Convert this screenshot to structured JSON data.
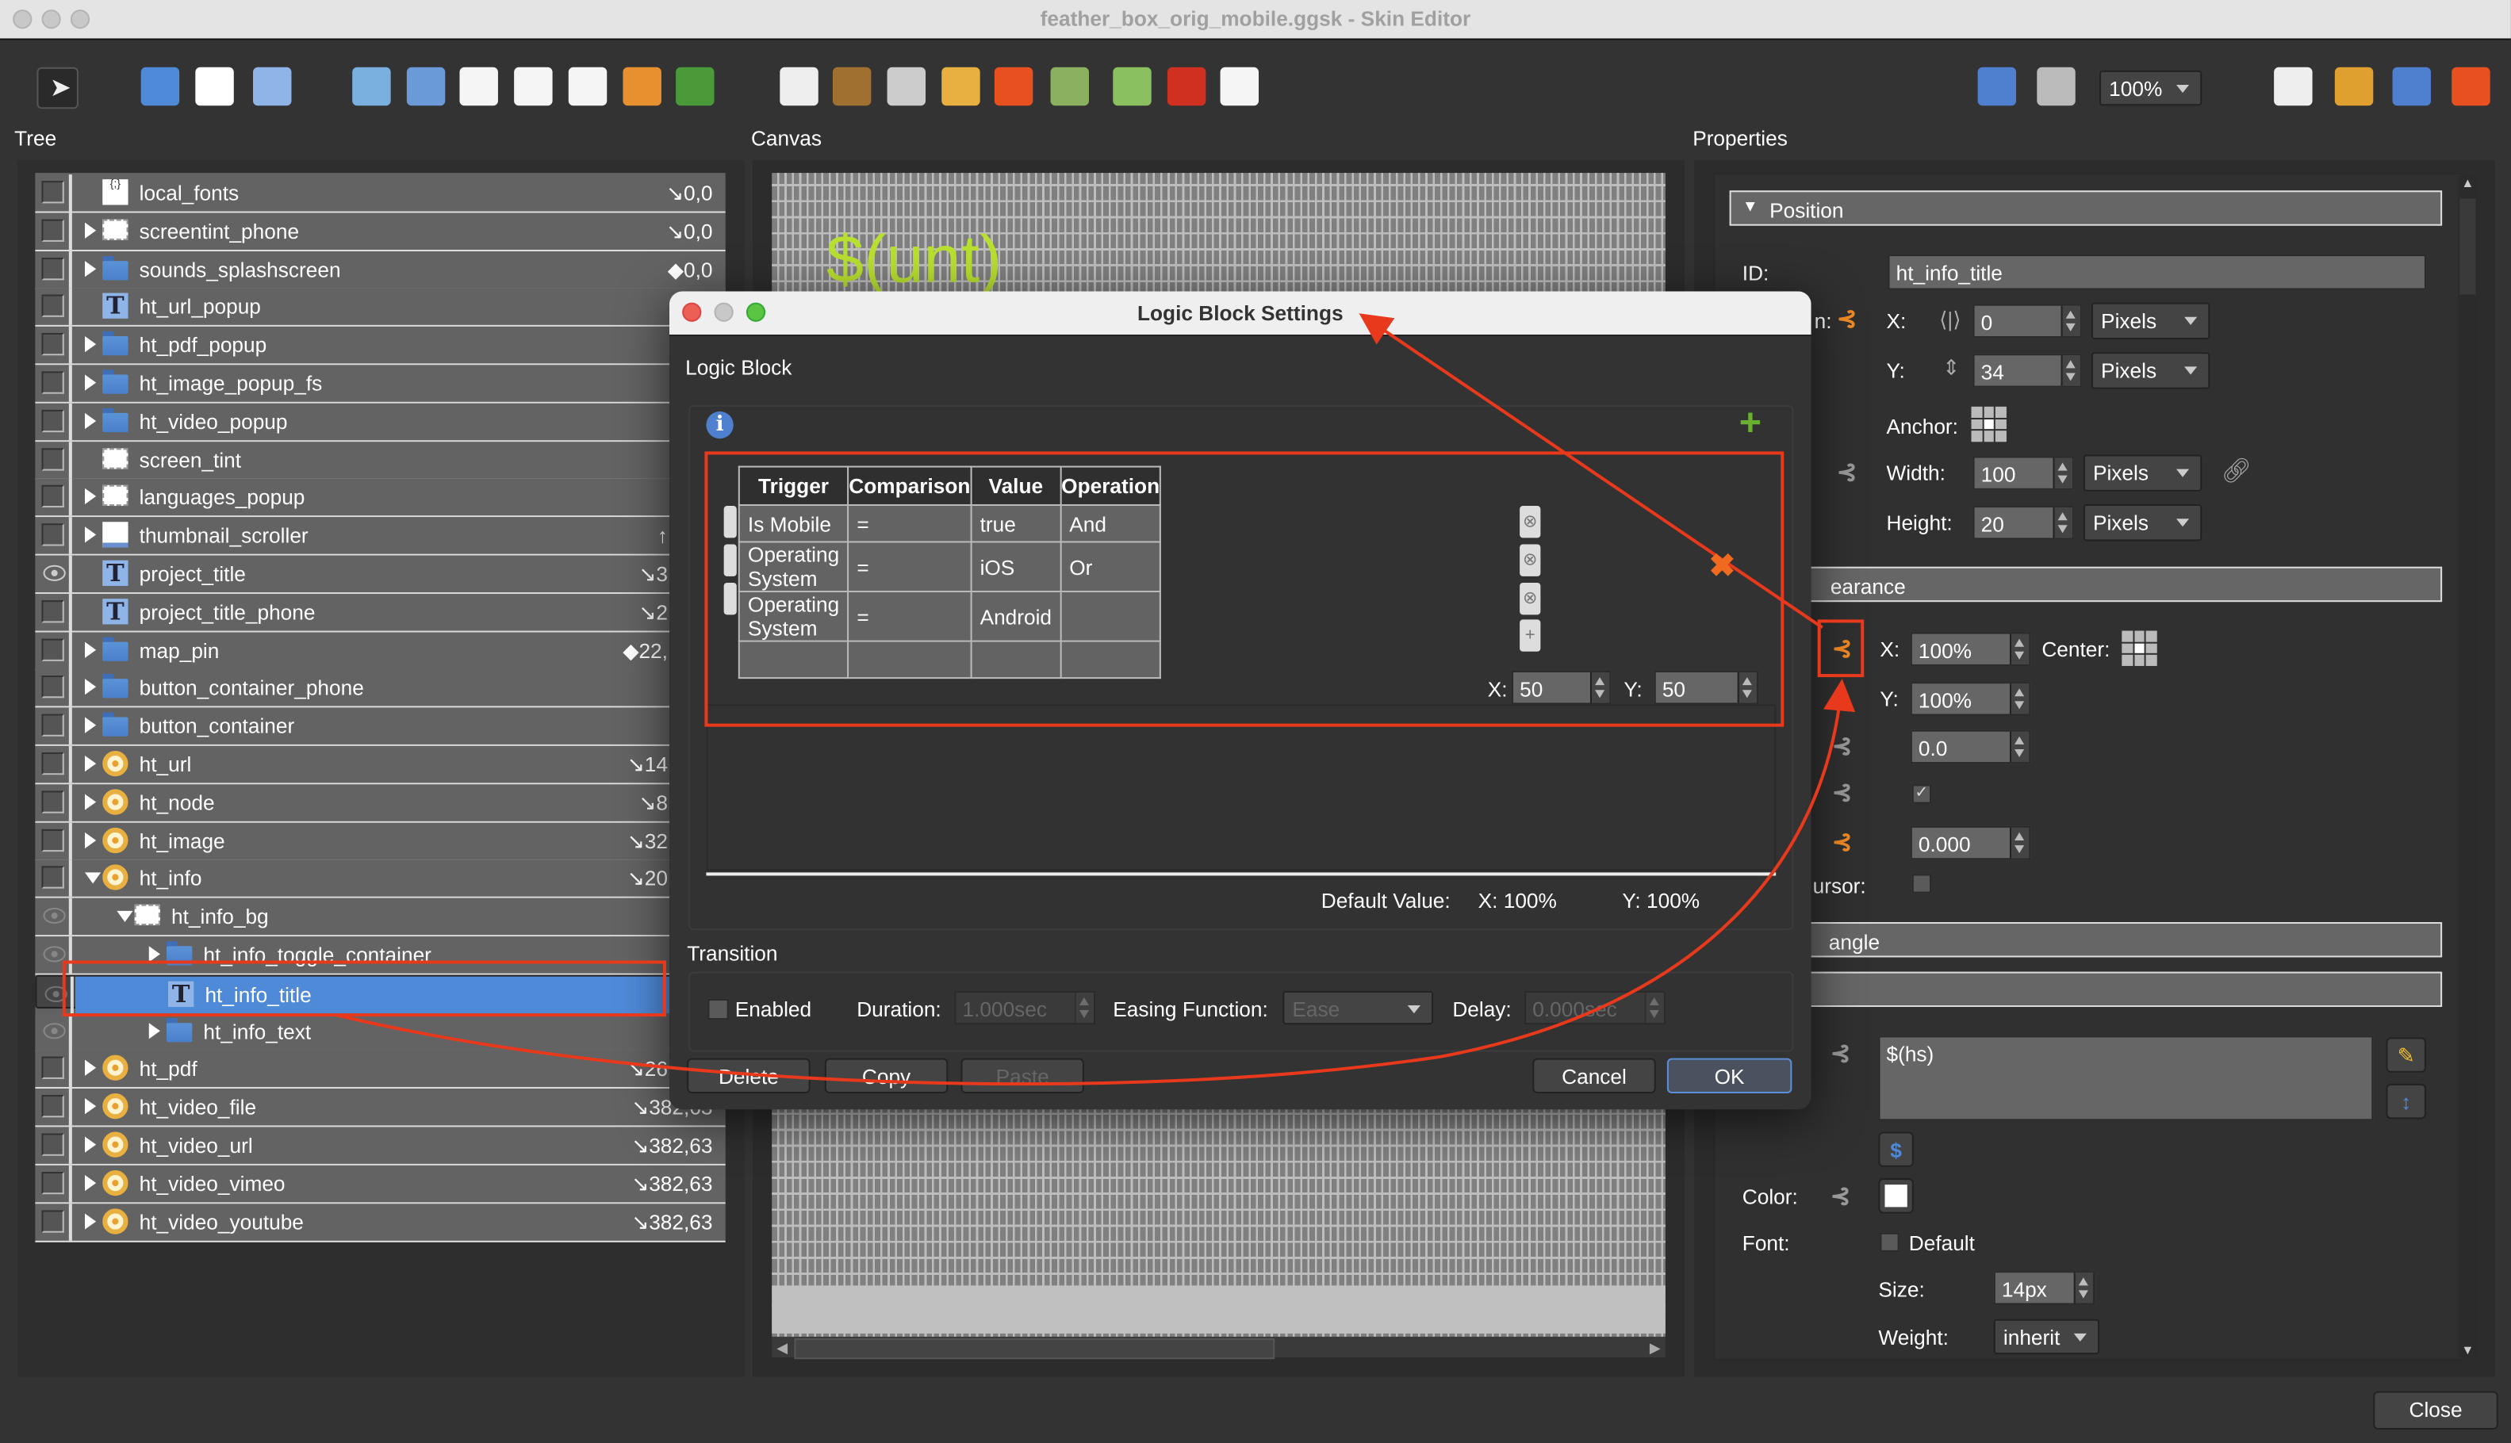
{
  "window": {
    "title": "feather_box_orig_mobile.ggsk - Skin Editor"
  },
  "toolbar": {
    "left_icons": [
      "select-pointer-icon",
      "container-folder-icon",
      "rectangle-icon",
      "text-icon",
      "image-icon",
      "button-icon",
      "svg-icon",
      "lottie-icon",
      "pdf-icon",
      "panorama-icon",
      "map-icon",
      "cloner-icon",
      "grid-icon",
      "timer-gauge-icon",
      "hotspot-icon",
      "map-pin-icon",
      "map-image-icon",
      "video-icon",
      "slider-icon",
      "code-js-icon"
    ],
    "right_icons": [
      "undo-icon",
      "zoom-icon",
      "find-icon",
      "theme-icon",
      "translate-icon",
      "tools-icon"
    ],
    "zoom_value": "100%"
  },
  "panels": {
    "tree": "Tree",
    "canvas": "Canvas",
    "properties": "Properties"
  },
  "tree": {
    "rows": [
      {
        "label": "local_fonts",
        "level": 0,
        "exp": "",
        "icon": "js",
        "value": "↘0,0",
        "vis": "box"
      },
      {
        "label": "screentint_phone",
        "level": 0,
        "exp": "c",
        "icon": "rect",
        "value": "↘0,0",
        "vis": "box"
      },
      {
        "label": "sounds_splashscreen",
        "level": 0,
        "exp": "c",
        "icon": "folder",
        "value": "◆0,0",
        "vis": "box"
      },
      {
        "label": "ht_url_popup",
        "level": 0,
        "exp": "",
        "icon": "text",
        "value": "",
        "vis": "box"
      },
      {
        "label": "ht_pdf_popup",
        "level": 0,
        "exp": "c",
        "icon": "folder",
        "value": "",
        "vis": "box"
      },
      {
        "label": "ht_image_popup_fs",
        "level": 0,
        "exp": "c",
        "icon": "folder",
        "value": "",
        "vis": "box"
      },
      {
        "label": "ht_video_popup",
        "level": 0,
        "exp": "c",
        "icon": "folder",
        "value": "",
        "vis": "box"
      },
      {
        "label": "screen_tint",
        "level": 0,
        "exp": "",
        "icon": "rect",
        "value": "",
        "vis": "box"
      },
      {
        "label": "languages_popup",
        "level": 0,
        "exp": "c",
        "icon": "rect",
        "value": "",
        "vis": "box"
      },
      {
        "label": "thumbnail_scroller",
        "level": 0,
        "exp": "c",
        "icon": "thumb",
        "value": "↑",
        "vis": "box"
      },
      {
        "label": "project_title",
        "level": 0,
        "exp": "",
        "icon": "text",
        "value": "↘3",
        "vis": "eye"
      },
      {
        "label": "project_title_phone",
        "level": 0,
        "exp": "",
        "icon": "text",
        "value": "↘2",
        "vis": "box"
      },
      {
        "label": "map_pin",
        "level": 0,
        "exp": "c",
        "icon": "folder",
        "value": "◆22,",
        "vis": "box"
      },
      {
        "label": "button_container_phone",
        "level": 0,
        "exp": "c",
        "icon": "folder",
        "value": "",
        "vis": "box"
      },
      {
        "label": "button_container",
        "level": 0,
        "exp": "c",
        "icon": "folder",
        "value": "",
        "vis": "box"
      },
      {
        "label": "ht_url",
        "level": 0,
        "exp": "c",
        "icon": "hot",
        "value": "↘14",
        "vis": "box"
      },
      {
        "label": "ht_node",
        "level": 0,
        "exp": "c",
        "icon": "hot",
        "value": "↘8",
        "vis": "box"
      },
      {
        "label": "ht_image",
        "level": 0,
        "exp": "c",
        "icon": "hot",
        "value": "↘32",
        "vis": "box"
      },
      {
        "label": "ht_info",
        "level": 0,
        "exp": "e",
        "icon": "hot",
        "value": "↘20",
        "vis": "box"
      },
      {
        "label": "ht_info_bg",
        "level": 1,
        "exp": "e",
        "icon": "rect",
        "value": "",
        "vis": "dim"
      },
      {
        "label": "ht_info_toggle_container",
        "level": 2,
        "exp": "c",
        "icon": "folder",
        "value": "",
        "vis": "dim"
      },
      {
        "label": "ht_info_title",
        "level": 2,
        "exp": "",
        "icon": "text",
        "value": "◆",
        "vis": "dim",
        "selected": true
      },
      {
        "label": "ht_info_text",
        "level": 2,
        "exp": "c",
        "icon": "folder",
        "value": "",
        "vis": "dim"
      },
      {
        "label": "ht_pdf",
        "level": 0,
        "exp": "c",
        "icon": "hot",
        "value": "↘26",
        "vis": "box"
      },
      {
        "label": "ht_video_file",
        "level": 0,
        "exp": "c",
        "icon": "hot",
        "value": "↘382,63",
        "vis": "box",
        "full": true
      },
      {
        "label": "ht_video_url",
        "level": 0,
        "exp": "c",
        "icon": "hot",
        "value": "↘382,63",
        "vis": "box",
        "full": true
      },
      {
        "label": "ht_video_vimeo",
        "level": 0,
        "exp": "c",
        "icon": "hot",
        "value": "↘382,63",
        "vis": "box",
        "full": true
      },
      {
        "label": "ht_video_youtube",
        "level": 0,
        "exp": "c",
        "icon": "hot",
        "value": "↘382,63",
        "vis": "box",
        "full": true
      }
    ]
  },
  "canvas": {
    "preview_text": "$(unt)",
    "preview_color": "#b8e030"
  },
  "properties": {
    "position_header": "Position",
    "id_label": "ID:",
    "id_value": "ht_info_title",
    "position_label_fragment": "n:",
    "x_label": "X:",
    "x_value": "0",
    "x_unit": "Pixels",
    "y_label": "Y:",
    "y_value": "34",
    "y_unit": "Pixels",
    "anchor_label": "Anchor:",
    "width_label": "Width:",
    "width_value": "100",
    "width_unit": "Pixels",
    "height_label": "Height:",
    "height_value": "20",
    "height_unit": "Pixels",
    "appearance_header_fragment": "earance",
    "scale_x_label": "X:",
    "scale_x_value": "100%",
    "center_label": "Center:",
    "scale_y_label": "Y:",
    "scale_y_value": "100%",
    "angle_value": "0.0",
    "visible_checked": true,
    "alpha_value": "0.000",
    "cursor_label_fragment": "ursor:",
    "rect_header_fragment": "angle",
    "text_value": "$(hs)",
    "color_label": "Color:",
    "color_value": "#ffffff",
    "font_label": "Font:",
    "font_default_label": "Default",
    "size_label": "Size:",
    "size_value": "14px",
    "weight_label": "Weight:",
    "weight_value": "inherit",
    "close_button": "Close"
  },
  "dialog": {
    "title": "Logic Block Settings",
    "section_label": "Logic Block",
    "columns": [
      "Trigger",
      "Comparison",
      "Value",
      "Operation"
    ],
    "rows": [
      {
        "trigger": "Is Mobile",
        "comparison": "=",
        "value": "true",
        "operation": "And"
      },
      {
        "trigger": "Operating System",
        "comparison": "=",
        "value": "iOS",
        "operation": "Or"
      },
      {
        "trigger": "Operating System",
        "comparison": "=",
        "value": "Android",
        "operation": ""
      }
    ],
    "x_label": "X:",
    "x_value": "50",
    "y_label": "Y:",
    "y_value": "50",
    "default_label": "Default Value:",
    "default_x": "X:  100%",
    "default_y": "Y:  100%",
    "transition_label": "Transition",
    "enabled_label": "Enabled",
    "duration_label": "Duration:",
    "duration_value": "1.000sec",
    "easing_label": "Easing Function:",
    "easing_value": "Ease",
    "delay_label": "Delay:",
    "delay_value": "0.000sec",
    "buttons": {
      "delete": "Delete",
      "copy": "Copy",
      "paste": "Paste",
      "cancel": "Cancel",
      "ok": "OK"
    }
  },
  "colors": {
    "accent_selection": "#4f8ad9",
    "annotation": "#e8391c",
    "logic_active": "#f08a24",
    "panel_bg": "#333333"
  }
}
